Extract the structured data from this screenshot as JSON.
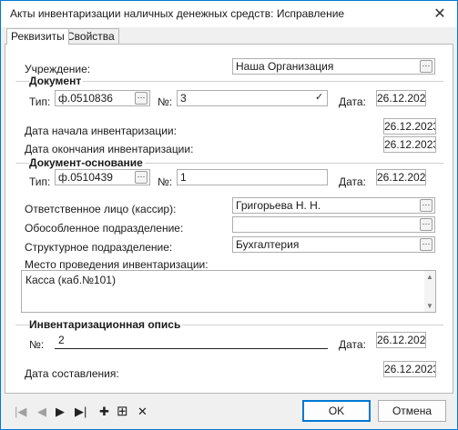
{
  "window": {
    "title": "Акты инвентаризации наличных денежных средств: Исправление",
    "close_glyph": "✕"
  },
  "tabs": [
    {
      "label": "Реквизиты"
    },
    {
      "label": "Свойства"
    }
  ],
  "form": {
    "institution_label": "Учреждение:",
    "institution_value": "Наша Организация",
    "document_group": "Документ",
    "doc_type_label": "Тип:",
    "doc_type_value": "ф.0510836",
    "doc_no_label": "№:",
    "doc_no_value": "3",
    "doc_date_label": "Дата:",
    "doc_date_value": "26.12.2023",
    "inv_start_label": "Дата начала инвентаризации:",
    "inv_start_value": "26.12.2023",
    "inv_end_label": "Дата окончания инвентаризации:",
    "inv_end_value": "26.12.2023",
    "basis_group": "Документ-основание",
    "basis_type_label": "Тип:",
    "basis_type_value": "ф.0510439",
    "basis_no_label": "№:",
    "basis_no_value": "1",
    "basis_date_label": "Дата:",
    "basis_date_value": "26.12.2023",
    "responsible_label": "Ответственное лицо (кассир):",
    "responsible_value": "Григорьева Н. Н.",
    "division_label": "Обособленное подразделение:",
    "division_value": "",
    "struct_label": "Структурное подразделение:",
    "struct_value": "Бухгалтерия",
    "place_label": "Место проведения инвентаризации:",
    "place_value": "Касса (каб.№101)",
    "inventory_group": "Инвентаризационная опись",
    "inv_no_label": "№:",
    "inv_no_value": "2",
    "inv_date_label": "Дата:",
    "inv_date_value": "26.12.2023",
    "compiled_label": "Дата составления:",
    "compiled_value": "26.12.2023"
  },
  "icons": {
    "ellipsis": "···",
    "check": "✓"
  },
  "navigation": {
    "first": "|◀",
    "prev": "◀",
    "next": "▶",
    "last": "▶|",
    "add": "✚",
    "add_copy": "⊞",
    "delete": "✕"
  },
  "buttons": {
    "ok": "OK",
    "cancel": "Отмена"
  }
}
